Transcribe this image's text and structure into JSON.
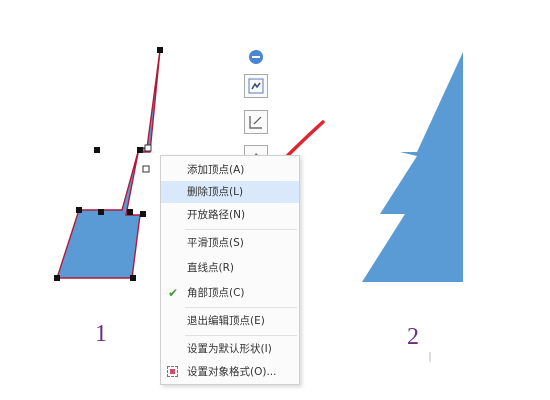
{
  "figure_labels": {
    "left": "1",
    "right": "2"
  },
  "context_menu": {
    "items": [
      {
        "label": "添加顶点(A)"
      },
      {
        "label": "删除顶点(L)",
        "selected": true
      },
      {
        "label": "开放路径(N)"
      },
      {
        "label": "平滑顶点(S)"
      },
      {
        "label": "直线点(R)"
      },
      {
        "label": "角部顶点(C)",
        "checked": true
      },
      {
        "label": "退出编辑顶点(E)"
      },
      {
        "label": "设置为默认形状(I)"
      },
      {
        "label": "设置对象格式(O)..."
      }
    ]
  },
  "colors": {
    "shape_fill": "#5b9bd5",
    "shape_outline_edit": "#b01a3a",
    "highlight_ellipse": "#e0252f",
    "arrow": "#e0252f",
    "label_color": "#6b2d7f",
    "selected_item": "#d9e8fb"
  },
  "icons": [
    "collapse-icon",
    "edit-shape-icon",
    "crop-icon",
    "fill-icon",
    "check-icon",
    "format-object-icon"
  ]
}
